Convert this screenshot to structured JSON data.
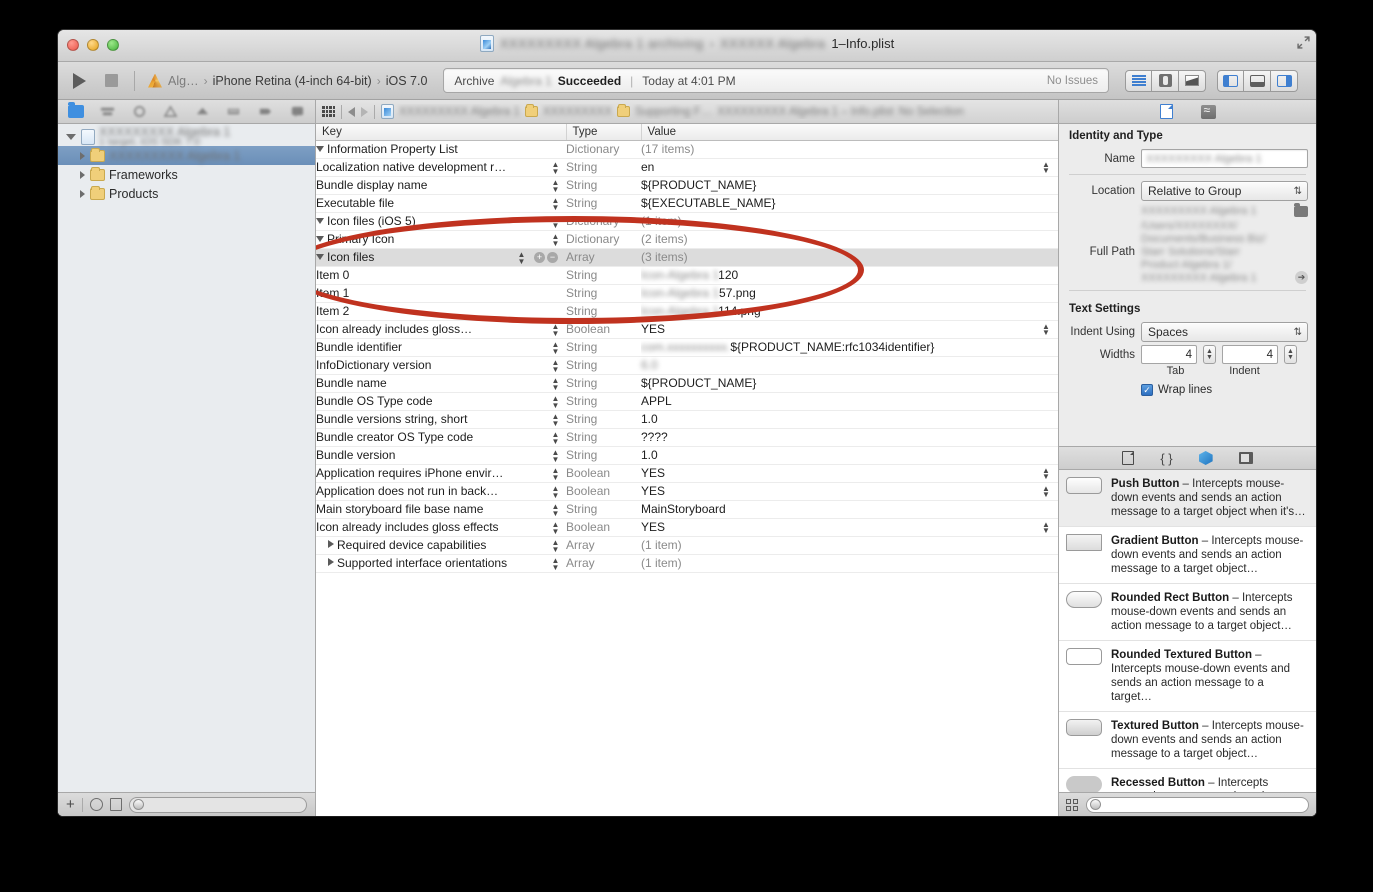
{
  "window": {
    "title_blurred_1": "XXXXXXXXX Algebra 1 archiving",
    "title_sep": "›",
    "title_blurred_2": "XXXXXX Algebra",
    "title_sharp": "1–Info.plist",
    "traffic": {
      "close": "close",
      "minimize": "minimize",
      "zoom": "zoom"
    }
  },
  "toolbar": {
    "run_label": "Run",
    "stop_label": "Stop",
    "scheme_name": "Alg…",
    "destination": "iPhone Retina (4-inch 64-bit)",
    "os_version": "iOS 7.0",
    "crumb_sep": "›",
    "status": {
      "prefix": "Archive",
      "blurred_target": "Algebra 1",
      "colon": ":",
      "result": "Succeeded",
      "divider": "|",
      "time": "Today at 4:01 PM",
      "issues": "No Issues"
    },
    "editor_segments": [
      "standard-editor",
      "assistant-editor",
      "version-editor"
    ],
    "view_segments": [
      "navigator-toggle",
      "debug-area-toggle",
      "utilities-toggle"
    ]
  },
  "navigator": {
    "tabs": [
      "project-navigator",
      "symbol-navigator",
      "find-navigator",
      "issue-navigator",
      "test-navigator",
      "debug-navigator",
      "breakpoint-navigator",
      "report-navigator"
    ],
    "items": [
      {
        "label": "XXXXXXXXX Algebra 1",
        "sub": "1 target, iOS SDK 7.0",
        "blurred": true,
        "kind": "project",
        "expanded": true,
        "selected": false
      },
      {
        "label": "XXXXXXXXX Algebra 1",
        "blurred": true,
        "kind": "folder",
        "expanded": false,
        "selected": true
      },
      {
        "label": "Frameworks",
        "blurred": false,
        "kind": "folder",
        "expanded": false,
        "selected": false
      },
      {
        "label": "Products",
        "blurred": false,
        "kind": "folder",
        "expanded": false,
        "selected": false
      }
    ],
    "bottom": {
      "add": "+",
      "filter_placeholder": ""
    }
  },
  "jumpbar": {
    "related_items": "related-items",
    "back": "◀",
    "forward": "▶",
    "crumbs": [
      {
        "text": "XXXXXXXXX Algebra 1",
        "blurred": true,
        "icon": "project-icon"
      },
      {
        "text": "XXXXXXXXX",
        "blurred": true,
        "icon": "folder-icon"
      },
      {
        "text": "Supporting F…",
        "blurred": true,
        "icon": "folder-icon"
      },
      {
        "text": "XXXXXXXXX Algebra 1 – Info.plist",
        "blurred": true,
        "icon": "none"
      },
      {
        "text": "No Selection",
        "blurred": true,
        "icon": "none"
      }
    ]
  },
  "plist": {
    "columns": [
      "Key",
      "Type",
      "Value"
    ],
    "rows": [
      {
        "key": "Information Property List",
        "type": "Dictionary",
        "value": "(17 items)",
        "indent": 0,
        "tri": "open",
        "value_dim": true,
        "stepper": false
      },
      {
        "key": "Localization native development r…",
        "type": "String",
        "value": "en",
        "indent": 1,
        "tri": "none",
        "stepper": true,
        "right_stepper": true
      },
      {
        "key": "Bundle display name",
        "type": "String",
        "value": "${PRODUCT_NAME}",
        "indent": 1,
        "tri": "none",
        "stepper": true
      },
      {
        "key": "Executable file",
        "type": "String",
        "value": "${EXECUTABLE_NAME}",
        "indent": 1,
        "tri": "none",
        "stepper": true
      },
      {
        "key": "Icon files (iOS 5)",
        "type": "Dictionary",
        "value": "(1 item)",
        "indent": 1,
        "tri": "open",
        "value_dim": true,
        "stepper": true
      },
      {
        "key": "Primary Icon",
        "type": "Dictionary",
        "value": "(2 items)",
        "indent": 2,
        "tri": "open",
        "value_dim": true,
        "stepper": true
      },
      {
        "key": "Icon files",
        "type": "Array",
        "value": "(3 items)",
        "indent": 3,
        "tri": "open",
        "value_dim": true,
        "stepper": true,
        "addremove": true,
        "selected": true,
        "type_stepper": true
      },
      {
        "key": "Item 0",
        "type": "String",
        "value": "120",
        "value_blur_prefix": "Icon-Algebra 1",
        "indent": 4,
        "tri": "none",
        "stepper": false
      },
      {
        "key": "Item 1",
        "type": "String",
        "value": "57.png",
        "value_blur_prefix": "Icon-Algebra 1",
        "indent": 4,
        "tri": "none",
        "stepper": false
      },
      {
        "key": "Item 2",
        "type": "String",
        "value": "114.png",
        "value_blur_prefix": "Icon-Algebra 1",
        "indent": 4,
        "tri": "none",
        "stepper": false
      },
      {
        "key": "Icon already includes gloss…",
        "type": "Boolean",
        "value": "YES",
        "indent": 2,
        "tri": "none",
        "stepper": true,
        "right_stepper": true
      },
      {
        "key": "Bundle identifier",
        "type": "String",
        "value": "${PRODUCT_NAME:rfc1034identifier}",
        "value_blur_prefix": "com.xxxxxxxxxx.",
        "indent": 1,
        "tri": "none",
        "stepper": true
      },
      {
        "key": "InfoDictionary version",
        "type": "String",
        "value": "6.0",
        "value_blur": true,
        "indent": 1,
        "tri": "none",
        "stepper": true
      },
      {
        "key": "Bundle name",
        "type": "String",
        "value": "${PRODUCT_NAME}",
        "indent": 1,
        "tri": "none",
        "stepper": true
      },
      {
        "key": "Bundle OS Type code",
        "type": "String",
        "value": "APPL",
        "indent": 1,
        "tri": "none",
        "stepper": true
      },
      {
        "key": "Bundle versions string, short",
        "type": "String",
        "value": "1.0",
        "indent": 1,
        "tri": "none",
        "stepper": true
      },
      {
        "key": "Bundle creator OS Type code",
        "type": "String",
        "value": "????",
        "indent": 1,
        "tri": "none",
        "stepper": true
      },
      {
        "key": "Bundle version",
        "type": "String",
        "value": "1.0",
        "indent": 1,
        "tri": "none",
        "stepper": true
      },
      {
        "key": "Application requires iPhone envir…",
        "type": "Boolean",
        "value": "YES",
        "indent": 1,
        "tri": "none",
        "stepper": true,
        "right_stepper": true
      },
      {
        "key": "Application does not run in back…",
        "type": "Boolean",
        "value": "YES",
        "indent": 1,
        "tri": "none",
        "stepper": true,
        "right_stepper": true
      },
      {
        "key": "Main storyboard file base name",
        "type": "String",
        "value": "MainStoryboard",
        "indent": 1,
        "tri": "none",
        "stepper": true
      },
      {
        "key": "Icon already includes gloss effects",
        "type": "Boolean",
        "value": "YES",
        "indent": 1,
        "tri": "none",
        "stepper": true,
        "right_stepper": true
      },
      {
        "key": "Required device capabilities",
        "type": "Array",
        "value": "(1 item)",
        "indent": 1,
        "tri": "closed",
        "value_dim": true,
        "stepper": true
      },
      {
        "key": "Supported interface orientations",
        "type": "Array",
        "value": "(1 item)",
        "indent": 1,
        "tri": "closed",
        "value_dim": true,
        "stepper": true
      }
    ],
    "annotation": {
      "shape": "ellipse",
      "color": "#c0321f"
    }
  },
  "inspector": {
    "tabs": [
      "file-inspector",
      "quick-help-inspector"
    ],
    "identity": {
      "section_title": "Identity and Type",
      "name_label": "Name",
      "name_value": "XXXXXXXXX Algebra 1",
      "location_label": "Location",
      "location_value": "Relative to Group",
      "location_path": "XXXXXXXXX Algebra 1",
      "fullpath_label": "Full Path",
      "fullpath_lines": [
        "/Users/XXXXXXXX/",
        "Documents/Business Biz/",
        "Starr Solutions/Starr",
        "Product Algebra 1/",
        "XXXXXXXXX Algebra 1"
      ]
    },
    "text_settings": {
      "section_title": "Text Settings",
      "indent_label": "Indent Using",
      "indent_value": "Spaces",
      "widths_label": "Widths",
      "tab_value": "4",
      "indent_value_num": "4",
      "tab_sublabel": "Tab",
      "indent_sublabel": "Indent",
      "wrap_label": "Wrap lines",
      "wrap_checked": true
    }
  },
  "library": {
    "tabs": [
      "file-template-library",
      "code-snippet-library",
      "object-library",
      "media-library"
    ],
    "items": [
      {
        "name": "Push Button",
        "desc": " – Intercepts mouse-down events and sends an action message to a target object when it's…",
        "thumb": "bt-push",
        "selected": true
      },
      {
        "name": "Gradient Button",
        "desc": " – Intercepts mouse-down events and sends an action message to a target object…",
        "thumb": "bt-grad",
        "selected": false
      },
      {
        "name": "Rounded Rect Button",
        "desc": " – Intercepts mouse-down events and sends an action message to a target object…",
        "thumb": "bt-round",
        "selected": false
      },
      {
        "name": "Rounded Textured Button",
        "desc": " – Intercepts mouse-down events and sends an action message to a target…",
        "thumb": "bt-rtex",
        "selected": false
      },
      {
        "name": "Textured Button",
        "desc": " – Intercepts mouse-down events and sends an action message to a target object…",
        "thumb": "bt-tex",
        "selected": false
      },
      {
        "name": "Recessed Button",
        "desc": " – Intercepts mouse-down events and sends an",
        "thumb": "bt-rec",
        "selected": false
      }
    ],
    "bottom": {
      "filter_placeholder": ""
    }
  }
}
